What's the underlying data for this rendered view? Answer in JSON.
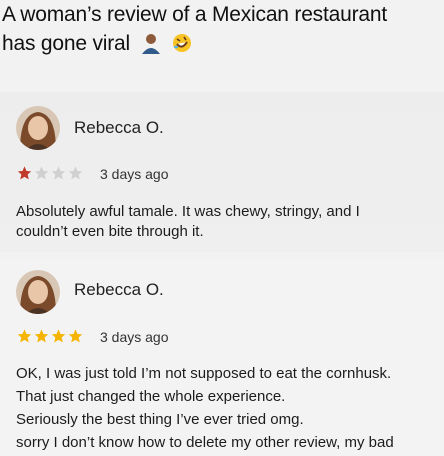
{
  "headline": {
    "line1": "A woman’s review of a Mexican restaurant",
    "line2": "has gone viral",
    "emojis": [
      "person-emoji",
      "rofl-emoji"
    ]
  },
  "reviews": [
    {
      "name": "Rebecca O.",
      "rating": 1,
      "max_rating": 4,
      "timestamp": "3 days ago",
      "text_lines": [
        "Absolutely awful tamale. It was chewy, stringy, and I",
        "couldn’t even bite through it."
      ]
    },
    {
      "name": "Rebecca O.",
      "rating": 4,
      "max_rating": 4,
      "timestamp": "3 days ago",
      "text_lines": [
        "OK, I was just told I’m not supposed to eat the cornhusk.",
        "That just changed the whole experience.",
        "Seriously the best thing I’ve ever tried omg.",
        "sorry I don’t know how to delete my other review, my bad"
      ]
    }
  ],
  "colors": {
    "star_filled_r1": "#c0392b",
    "star_filled_r2": "#f4b400",
    "star_empty": "#d0d0d0"
  }
}
